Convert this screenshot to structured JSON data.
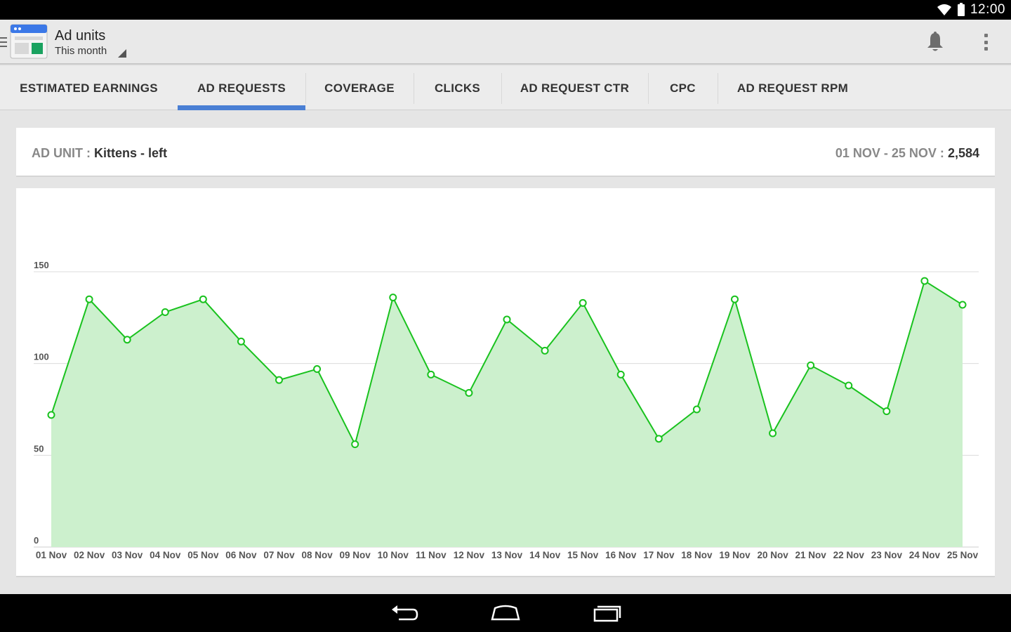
{
  "status_bar": {
    "time": "12:00"
  },
  "action_bar": {
    "title": "Ad units",
    "subtitle": "This month"
  },
  "tabs": [
    {
      "label": "ESTIMATED EARNINGS"
    },
    {
      "label": "AD REQUESTS"
    },
    {
      "label": "COVERAGE"
    },
    {
      "label": "CLICKS"
    },
    {
      "label": "AD REQUEST CTR"
    },
    {
      "label": "CPC"
    },
    {
      "label": "AD REQUEST RPM"
    }
  ],
  "active_tab": "AD REQUESTS",
  "summary": {
    "ad_unit_label": "AD UNIT :",
    "ad_unit_value": "Kittens - left",
    "range_label": "01 NOV - 25 NOV :",
    "range_value": "2,584"
  },
  "colors": {
    "accent": "#4a7fd4",
    "line": "#19c21e",
    "fill": "#ccf0cd"
  },
  "chart_data": {
    "type": "area",
    "x": [
      "01 Nov",
      "02 Nov",
      "03 Nov",
      "04 Nov",
      "05 Nov",
      "06 Nov",
      "07 Nov",
      "08 Nov",
      "09 Nov",
      "10 Nov",
      "11 Nov",
      "12 Nov",
      "13 Nov",
      "14 Nov",
      "15 Nov",
      "16 Nov",
      "17 Nov",
      "18 Nov",
      "19 Nov",
      "20 Nov",
      "21 Nov",
      "22 Nov",
      "23 Nov",
      "24 Nov",
      "25 Nov"
    ],
    "values": [
      72,
      135,
      113,
      128,
      135,
      112,
      91,
      97,
      56,
      136,
      94,
      84,
      124,
      107,
      133,
      94,
      59,
      75,
      135,
      62,
      99,
      88,
      74,
      145,
      132
    ],
    "yticks": [
      0,
      50,
      100,
      150
    ],
    "ylim": [
      0,
      150
    ],
    "grid": true
  }
}
